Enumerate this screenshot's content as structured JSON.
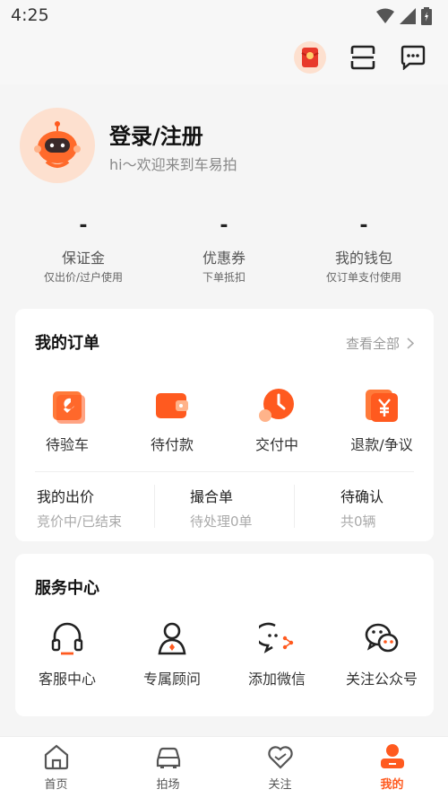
{
  "status_bar": {
    "time": "4:25"
  },
  "profile": {
    "login_label": "登录/注册",
    "welcome_text": "hi～欢迎来到车易拍"
  },
  "stats": [
    {
      "value": "-",
      "label": "保证金",
      "sub": "仅出价/过户使用"
    },
    {
      "value": "-",
      "label": "优惠券",
      "sub": "下单抵扣"
    },
    {
      "value": "-",
      "label": "我的钱包",
      "sub": "仅订单支付使用"
    }
  ],
  "orders": {
    "title": "我的订单",
    "view_all": "查看全部",
    "items": [
      {
        "label": "待验车",
        "icon": "wrench-icon"
      },
      {
        "label": "待付款",
        "icon": "wallet-icon"
      },
      {
        "label": "交付中",
        "icon": "clock-icon"
      },
      {
        "label": "退款/争议",
        "icon": "yuan-icon"
      }
    ],
    "bids": [
      {
        "title": "我的出价",
        "sub": "竞价中/已结束"
      },
      {
        "title": "撮合单",
        "sub": "待处理0单"
      },
      {
        "title": "待确认",
        "sub": "共0辆"
      }
    ]
  },
  "services": {
    "title": "服务中心",
    "items": [
      {
        "label": "客服中心",
        "icon": "headset-icon"
      },
      {
        "label": "专属顾问",
        "icon": "advisor-icon"
      },
      {
        "label": "添加微信",
        "icon": "chat-add-icon"
      },
      {
        "label": "关注公众号",
        "icon": "wechat-icon"
      }
    ]
  },
  "tabs": [
    {
      "label": "首页",
      "icon": "home-icon"
    },
    {
      "label": "拍场",
      "icon": "car-icon"
    },
    {
      "label": "关注",
      "icon": "heart-icon"
    },
    {
      "label": "我的",
      "icon": "user-icon",
      "active": true
    }
  ],
  "colors": {
    "accent": "#ff5a1f",
    "background": "#f5f5f5"
  }
}
